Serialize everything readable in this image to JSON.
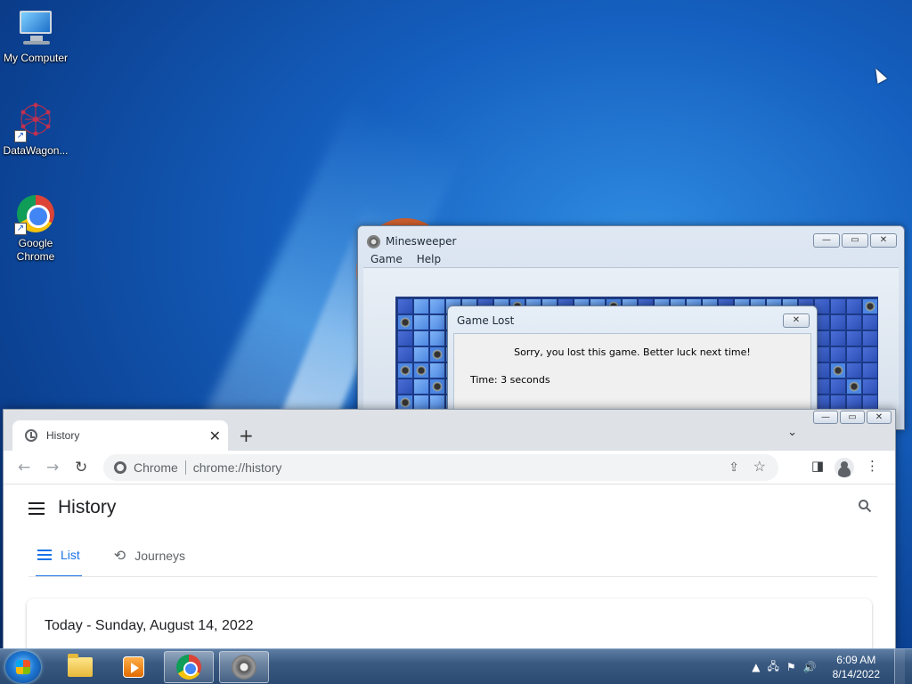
{
  "desktop": {
    "icons": [
      {
        "label": "My Computer",
        "icon": "monitor-icon"
      },
      {
        "label": "DataWagon...",
        "icon": "molecule-icon"
      },
      {
        "label": "Google Chrome",
        "icon": "chrome-icon"
      }
    ]
  },
  "minesweeper": {
    "title": "Minesweeper",
    "menu": [
      "Game",
      "Help"
    ],
    "controls": {
      "minimize": "—",
      "maximize": "▭",
      "close": "✕"
    }
  },
  "dialog": {
    "title": "Game Lost",
    "message": "Sorry, you lost this game. Better luck next time!",
    "time": "Time: 3 seconds",
    "close": "✕"
  },
  "chrome": {
    "tab_title": "History",
    "tab_close": "✕",
    "new_tab": "+",
    "tab_dropdown": "⌄",
    "omnibox": {
      "chip": "Chrome",
      "url": "chrome://history"
    },
    "page_title": "History",
    "tabs": [
      {
        "label": "List",
        "active": true
      },
      {
        "label": "Journeys",
        "active": false
      }
    ],
    "date_heading": "Today - Sunday, August 14, 2022",
    "accent": "#1a73e8"
  },
  "taskbar": {
    "time": "6:09 AM",
    "date": "8/14/2022"
  }
}
